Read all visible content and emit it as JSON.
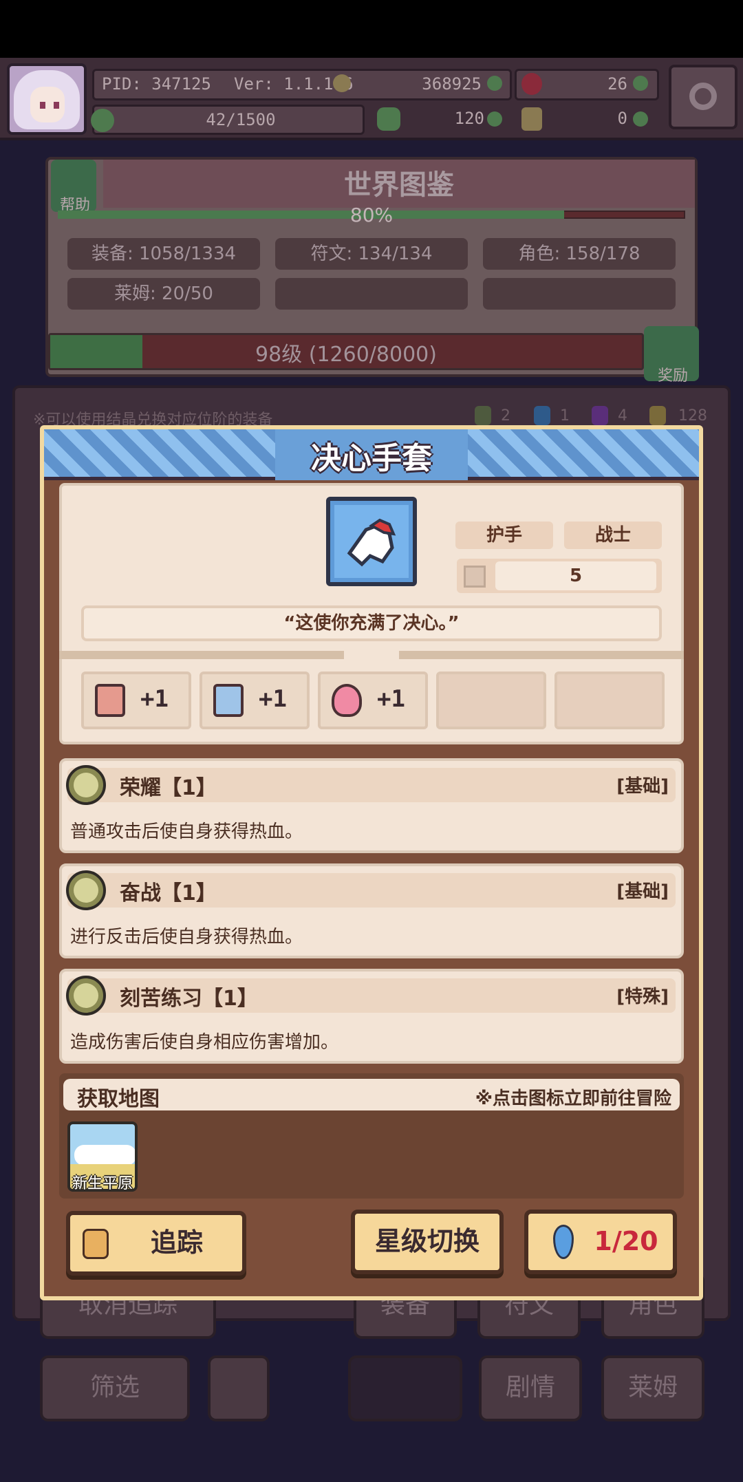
{
  "status": {
    "pid": "PID: 347125",
    "version": "Ver: 1.1.1.6",
    "gold": "368925",
    "red_gem": "26",
    "stamina": "42/1500",
    "clover": "120",
    "key": "0"
  },
  "codex": {
    "title": "世界图鉴",
    "help_label": "帮助",
    "percent": "80%",
    "percent_value": 0.8,
    "stats": [
      "装备: 1058/1334",
      "符文: 134/134",
      "角色: 158/178",
      "莱姆: 20/50"
    ],
    "level_text": "98级 (1260/8000)",
    "level_progress": 0.1575,
    "reward_label": "奖励"
  },
  "background": {
    "hint": "※可以使用结晶兑换对应位阶的装备",
    "gem_counts": [
      "2",
      "1",
      "4",
      "128"
    ],
    "buttons": [
      "取消追踪",
      "装备",
      "符文",
      "角色",
      "筛选",
      "剧情",
      "莱姆"
    ]
  },
  "modal": {
    "title": "决心手套",
    "item_icon": "gauntlet-icon",
    "tags": [
      "护手",
      "战士"
    ],
    "level": "5",
    "quote": "“这使你充满了决心。”",
    "stats": [
      {
        "icon": "fist-icon",
        "value": "+1",
        "color": "#e59a8e"
      },
      {
        "icon": "book-icon",
        "value": "+1",
        "color": "#9fc4e8"
      },
      {
        "icon": "heart-icon",
        "value": "+1",
        "color": "#f08aa4"
      }
    ],
    "skills": [
      {
        "name": "荣耀【1】",
        "type": "[基础]",
        "desc": "普通攻击后使自身获得热血。"
      },
      {
        "name": "奋战【1】",
        "type": "[基础]",
        "desc": "进行反击后使自身获得热血。"
      },
      {
        "name": "刻苦练习【1】",
        "type": "[特殊]",
        "desc": "造成伤害后使自身相应伤害增加。"
      }
    ],
    "map": {
      "title": "获取地图",
      "hint": "※点击图标立即前往冒险",
      "tiles": [
        {
          "label": "新生平原"
        }
      ]
    },
    "buttons": {
      "track": "追踪",
      "star_switch": "星级切换",
      "count": "1/20"
    }
  },
  "colors": {
    "header_blue": "#6aa0d8",
    "panel_cream": "#f3e4d6",
    "button_yellow": "#f6d79a",
    "count_red": "#c8283c"
  }
}
